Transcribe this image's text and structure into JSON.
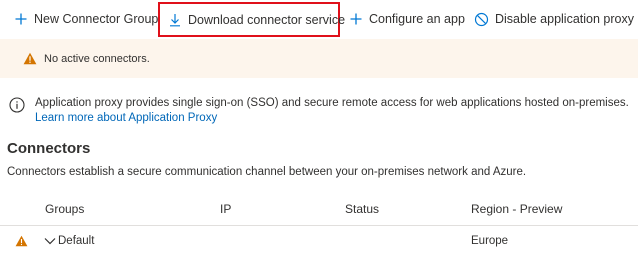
{
  "toolbar": {
    "new_group_label": "New Connector Group",
    "download_label": "Download connector service",
    "configure_label": "Configure an app",
    "disable_label": "Disable application proxy"
  },
  "warning": {
    "text": "No active connectors."
  },
  "info": {
    "text": "Application proxy provides single sign-on (SSO) and secure remote access for web applications hosted on-premises.",
    "link": "Learn more about Application Proxy"
  },
  "connectors": {
    "title": "Connectors",
    "description": "Connectors establish a secure communication channel between your on-premises network and Azure."
  },
  "table": {
    "columns": [
      "Groups",
      "IP",
      "Status",
      "Region - Preview"
    ],
    "rows": [
      {
        "group": "Default",
        "ip": "",
        "status": "",
        "region": "Europe",
        "warning": true
      }
    ]
  },
  "colors": {
    "accent": "#0078d4",
    "link": "#0067b8",
    "warning": "#d47500",
    "warning_bg": "#fdf5ec",
    "highlight_border": "#e0101a"
  },
  "icons": {
    "new": "plus-icon",
    "download": "download-icon",
    "configure": "plus-icon",
    "disable": "block-icon",
    "warning": "warning-icon",
    "info": "info-icon",
    "expand": "chevron-down-icon"
  }
}
